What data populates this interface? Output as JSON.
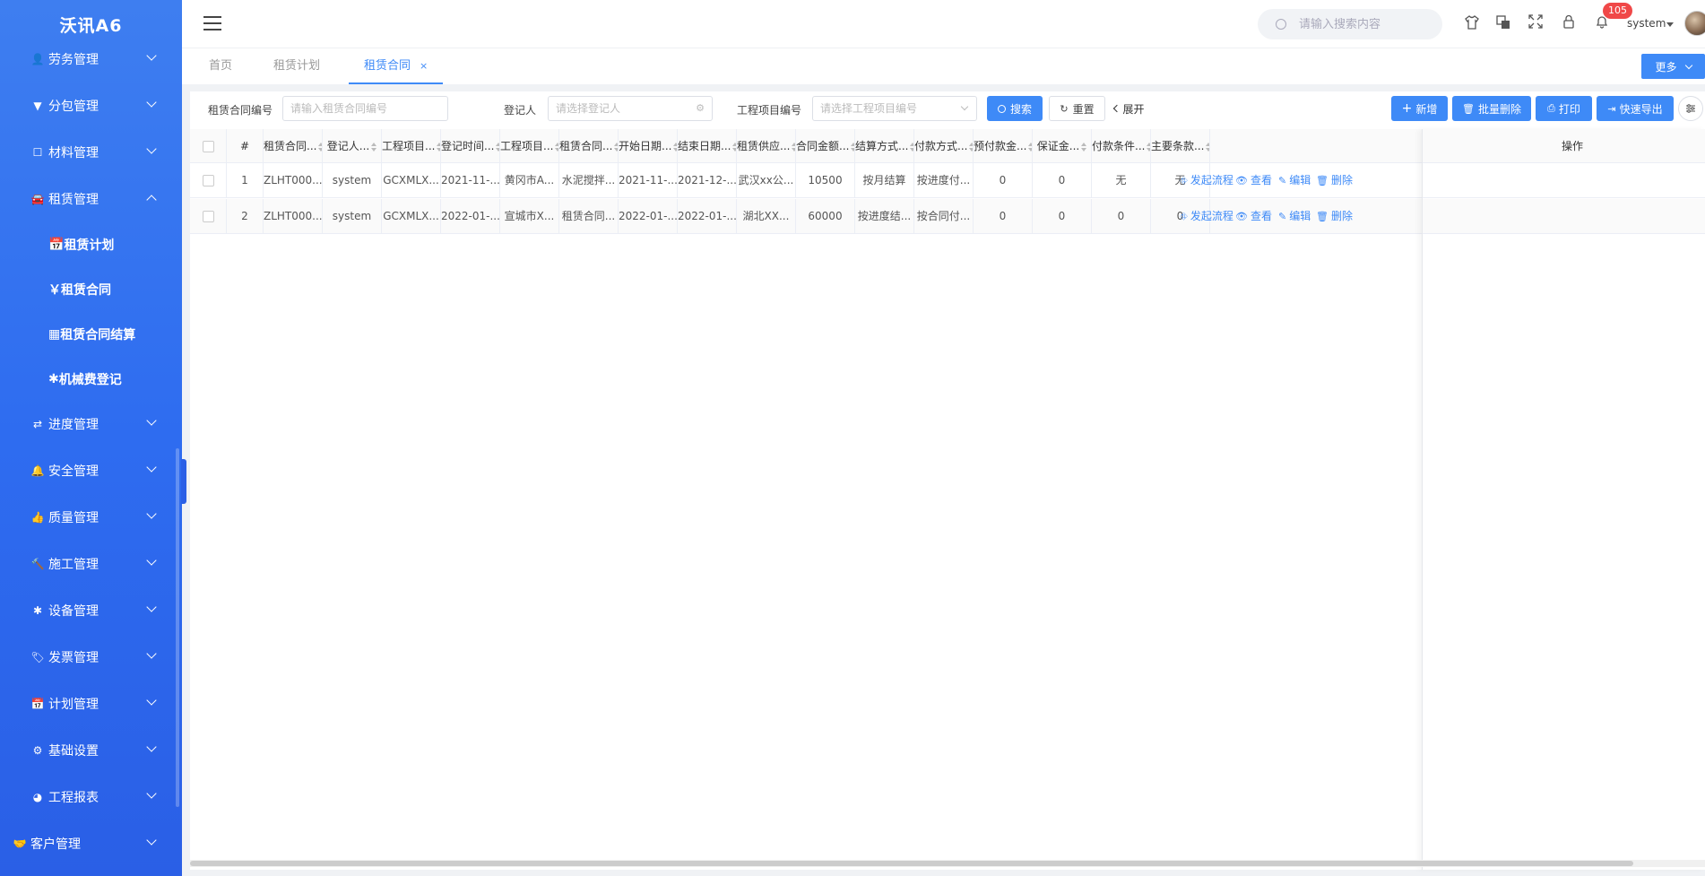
{
  "app": {
    "title": "沃讯A6"
  },
  "sidebar": {
    "items": [
      {
        "label": "劳务管理",
        "icon": "person-icon",
        "glyph": "👤"
      },
      {
        "label": "分包管理",
        "icon": "filter-icon",
        "glyph": "▼"
      },
      {
        "label": "材料管理",
        "icon": "box-icon",
        "glyph": "☐"
      },
      {
        "label": "租赁管理",
        "icon": "car-icon",
        "glyph": "🚘"
      },
      {
        "label": "进度管理",
        "icon": "shuffle-icon",
        "glyph": "⇄"
      },
      {
        "label": "安全管理",
        "icon": "bell-icon",
        "glyph": "🔔"
      },
      {
        "label": "质量管理",
        "icon": "thumbs-up-icon",
        "glyph": "👍"
      },
      {
        "label": "施工管理",
        "icon": "hammer-icon",
        "glyph": "🔨"
      },
      {
        "label": "设备管理",
        "icon": "asterisk-icon",
        "glyph": "✱"
      },
      {
        "label": "发票管理",
        "icon": "tag-icon",
        "glyph": "🏷"
      },
      {
        "label": "计划管理",
        "icon": "calendar-plus-icon",
        "glyph": "📅"
      },
      {
        "label": "基础设置",
        "icon": "gear-icon",
        "glyph": "⚙"
      },
      {
        "label": "工程报表",
        "icon": "pie-chart-icon",
        "glyph": "◕"
      },
      {
        "label": "客户管理",
        "icon": "handshake-icon",
        "glyph": "🤝"
      }
    ],
    "submenu": [
      {
        "label": "租赁计划",
        "icon": "calendar-plus-icon",
        "glyph": "📅"
      },
      {
        "label": "租赁合同",
        "icon": "yen-sign-icon",
        "glyph": "￥"
      },
      {
        "label": "租赁合同结算",
        "icon": "calculator-icon",
        "glyph": "▦"
      },
      {
        "label": "机械费登记",
        "icon": "asterisk-icon",
        "glyph": "✱"
      }
    ]
  },
  "header": {
    "search_placeholder": "请输入搜索内容",
    "notification_count": "105",
    "username": "system"
  },
  "tabs": [
    {
      "label": "首页"
    },
    {
      "label": "租赁计划"
    },
    {
      "label": "租赁合同",
      "active": true,
      "close": "×"
    }
  ],
  "more_label": "更多",
  "filters": {
    "contract_no_label": "租赁合同编号",
    "contract_no_placeholder": "请输入租赁合同编号",
    "registrant_label": "登记人",
    "registrant_placeholder": "请选择登记人",
    "project_no_label": "工程项目编号",
    "project_no_placeholder": "请选择工程项目编号",
    "search_btn": "搜索",
    "reset_btn": "重置",
    "expand_btn": "展开"
  },
  "actions": {
    "add": "新增",
    "batch_delete": "批量删除",
    "print": "打印",
    "quick_export": "快速导出"
  },
  "table": {
    "columns": [
      "#",
      "租赁合同...",
      "登记人...",
      "工程项目...",
      "登记时间...",
      "工程项目...",
      "租赁合同...",
      "开始日期...",
      "结束日期...",
      "租赁供应...",
      "合同金额...",
      "结算方式...",
      "付款方式...",
      "预付款金...",
      "保证金...",
      "付款条件...",
      "主要条款..."
    ],
    "op_header": "操作",
    "rows": [
      [
        "1",
        "ZLHT000...",
        "system",
        "GCXMLX...",
        "2021-11-...",
        "黄冈市A...",
        "水泥搅拌...",
        "2021-11-...",
        "2021-12-...",
        "武汉xx公...",
        "10500",
        "按月结算",
        "按进度付...",
        "0",
        "0",
        "无",
        "无"
      ],
      [
        "2",
        "ZLHT000...",
        "system",
        "GCXMLX...",
        "2022-01-...",
        "宣城市X...",
        "租赁合同...",
        "2022-01-...",
        "2022-01-...",
        "湖北XX...",
        "60000",
        "按进度结...",
        "按合同付...",
        "0",
        "0",
        "0",
        "0"
      ]
    ],
    "row_ops": [
      "发起流程",
      "查看",
      "编辑",
      "删除"
    ]
  },
  "colors": {
    "sidebar_bg": "#2e6cf0",
    "accent": "#3e8af7",
    "badge": "#f04848"
  }
}
